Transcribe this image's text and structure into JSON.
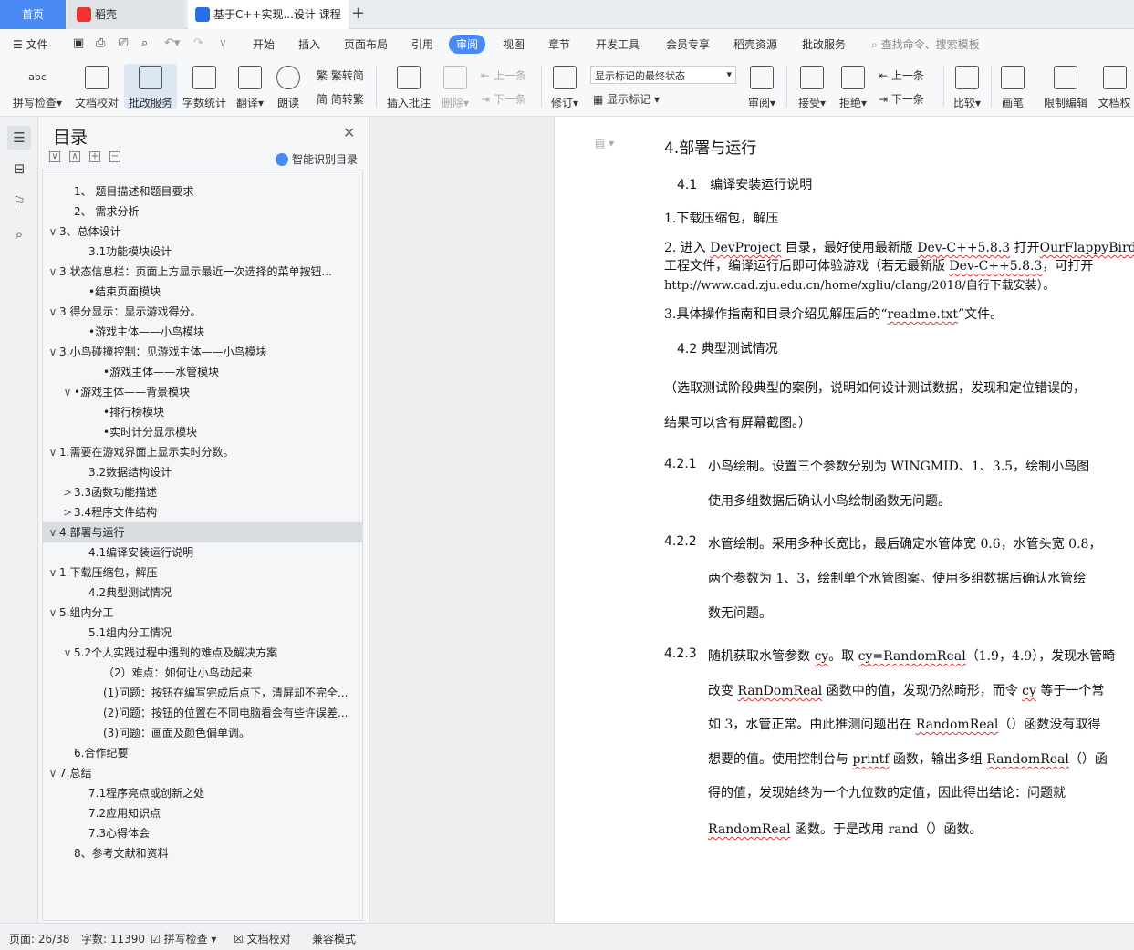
{
  "tabs": {
    "home": "首页",
    "daoke": "稻壳",
    "document": "基于C++实现...设计 课程论"
  },
  "menu": {
    "file": "文件",
    "items": [
      "开始",
      "插入",
      "页面布局",
      "引用",
      "审阅",
      "视图",
      "章节",
      "开发工具",
      "会员专享",
      "稻壳资源",
      "批改服务"
    ],
    "active": "审阅",
    "search_placeholder": "查找命令、搜索模板"
  },
  "ribbon": {
    "spell_check": "拼写检查",
    "doc_proof": "文档校对",
    "review_service": "批改服务",
    "word_count": "字数统计",
    "translate": "翻译",
    "read_aloud": "朗读",
    "trad_to_simp": "繁转简",
    "simp_to_trad": "简转繁",
    "insert_comment": "插入批注",
    "delete": "删除",
    "prev_comment": "上一条",
    "next_comment": "下一条",
    "track_changes": "修订",
    "display_state": "显示标记的最终状态",
    "show_markup": "显示标记",
    "review": "审阅",
    "accept": "接受",
    "reject": "拒绝",
    "prev_change": "上一条",
    "next_change": "下一条",
    "compare": "比较",
    "pen": "画笔",
    "restrict_edit": "限制编辑",
    "doc_permission": "文档权"
  },
  "toc": {
    "title": "目录",
    "ai_label": "智能识别目录",
    "items": [
      {
        "text": "1、 题目描述和题目要求",
        "caret": ""
      },
      {
        "text": "2、 需求分析",
        "caret": ""
      },
      {
        "text": "3、总体设计",
        "caret": "∨"
      },
      {
        "text": "3.1功能模块设计",
        "caret": ""
      },
      {
        "text": "3.状态信息栏：页面上方显示最近一次选择的菜单按钮...",
        "caret": "∨"
      },
      {
        "text": "•结束页面模块",
        "caret": ""
      },
      {
        "text": "3.得分显示：显示游戏得分。",
        "caret": "∨"
      },
      {
        "text": "•游戏主体——小鸟模块",
        "caret": ""
      },
      {
        "text": "3.小鸟碰撞控制：见游戏主体——小鸟模块",
        "caret": "∨"
      },
      {
        "text": "•游戏主体——水管模块",
        "caret": ""
      },
      {
        "text": "•游戏主体——背景模块",
        "caret": "∨"
      },
      {
        "text": "•排行榜模块",
        "caret": ""
      },
      {
        "text": "•实时计分显示模块",
        "caret": ""
      },
      {
        "text": "1.需要在游戏界面上显示实时分数。",
        "caret": "∨"
      },
      {
        "text": "3.2数据结构设计",
        "caret": ""
      },
      {
        "text": "3.3函数功能描述",
        "caret": ">"
      },
      {
        "text": "3.4程序文件结构",
        "caret": ">"
      },
      {
        "text": "4.部署与运行",
        "caret": "∨"
      },
      {
        "text": "4.1编译安装运行说明",
        "caret": ""
      },
      {
        "text": "1.下载压缩包，解压",
        "caret": "∨"
      },
      {
        "text": "4.2典型测试情况",
        "caret": ""
      },
      {
        "text": "5.组内分工",
        "caret": "∨"
      },
      {
        "text": "5.1组内分工情况",
        "caret": ""
      },
      {
        "text": "5.2个人实践过程中遇到的难点及解决方案",
        "caret": "∨"
      },
      {
        "text": "（2）难点：如何让小鸟动起来",
        "caret": ""
      },
      {
        "text": "(1)问题：按钮在编写完成后点下，清屏却不完全...",
        "caret": ""
      },
      {
        "text": "(2)问题：按钮的位置在不同电脑看会有些许误差...",
        "caret": ""
      },
      {
        "text": "(3)问题：画面及颜色偏单调。",
        "caret": ""
      },
      {
        "text": "6.合作纪要",
        "caret": ""
      },
      {
        "text": "7.总结",
        "caret": "∨"
      },
      {
        "text": "7.1程序亮点或创新之处",
        "caret": ""
      },
      {
        "text": "7.2应用知识点",
        "caret": ""
      },
      {
        "text": "7.3心得体会",
        "caret": ""
      },
      {
        "text": "8、参考文献和资料",
        "caret": ""
      }
    ]
  },
  "document": {
    "heading": "4.部署与运行",
    "sub41": "4.1　编译安装运行说明",
    "p1": "1.下载压缩包，解压",
    "p2a_pre": "2. 进入 ",
    "p2a_dev": "DevProject",
    "p2a_mid": " 目录，最好使用最新版 ",
    "p2a_devc": "Dev-C++5.8.3",
    "p2a_open": " 打开",
    "p2a_ofb": "OurFlappyBird",
    "p2b_pre": "工程文件，编译运行后即可体验游戏（若无最新版 ",
    "p2b_devc": "Dev-C++5.8.3",
    "p2b_post": "，可打开",
    "p2c": "http://www.cad.zju.edu.cn/home/xgliu/clang/2018/自行下载安装）。",
    "p3_pre": "3.具体操作指南和目录介绍见解压后的“",
    "p3_file": "readme.txt",
    "p3_post": "”文件。",
    "sub42": "4.2 典型测试情况",
    "note1": "（选取测试阶段典型的案例，说明如何设计测试数据，发现和定位错误的，",
    "note2": "结果可以含有屏幕截图。）",
    "n421": "4.2.1",
    "t421a": "小鸟绘制。设置三个参数分别为 WINGMID、1、3.5，绘制小鸟图",
    "t421b": "使用多组数据后确认小鸟绘制函数无问题。",
    "n422": "4.2.2",
    "t422a": "水管绘制。采用多种长宽比，最后确定水管体宽 0.6，水管头宽 0.8，",
    "t422b": "两个参数为 1、3，绘制单个水管图案。使用多组数据后确认水管绘",
    "t422c": "数无问题。",
    "n423": "4.2.3",
    "t423a_pre": "随机获取水管参数 ",
    "t423a_cy": "cy",
    "t423a_mid": "。取 ",
    "t423a_rr": "cy=RandomReal",
    "t423a_post": "（1.9，4.9），发现水管畸",
    "t423b_pre": "改变 ",
    "t423b_rr": "RanDomReal",
    "t423b_mid": " 函数中的值，发现仍然畸形，而令 ",
    "t423b_cy": "cy",
    "t423b_post": " 等于一个常",
    "t423c_pre": "如 3，水管正常。由此推测问题出在 ",
    "t423c_rr": "RandomReal",
    "t423c_post": "（）函数没有取得",
    "t423d_pre": "想要的值。使用控制台与 ",
    "t423d_pf": "printf",
    "t423d_mid": " 函数，输出多组 ",
    "t423d_rr": "RandomReal",
    "t423d_post": "（）函",
    "t423e": "得的值，发现始终为一个九位数的定值，因此得出结论：问题就",
    "t423f_rr": "RandomReal",
    "t423f_post": " 函数。于是改用 rand（）函数。"
  },
  "status": {
    "page": "页面: 26/38",
    "words": "字数: 11390",
    "spell": "拼写检查",
    "proof": "文档校对",
    "compat": "兼容模式"
  }
}
